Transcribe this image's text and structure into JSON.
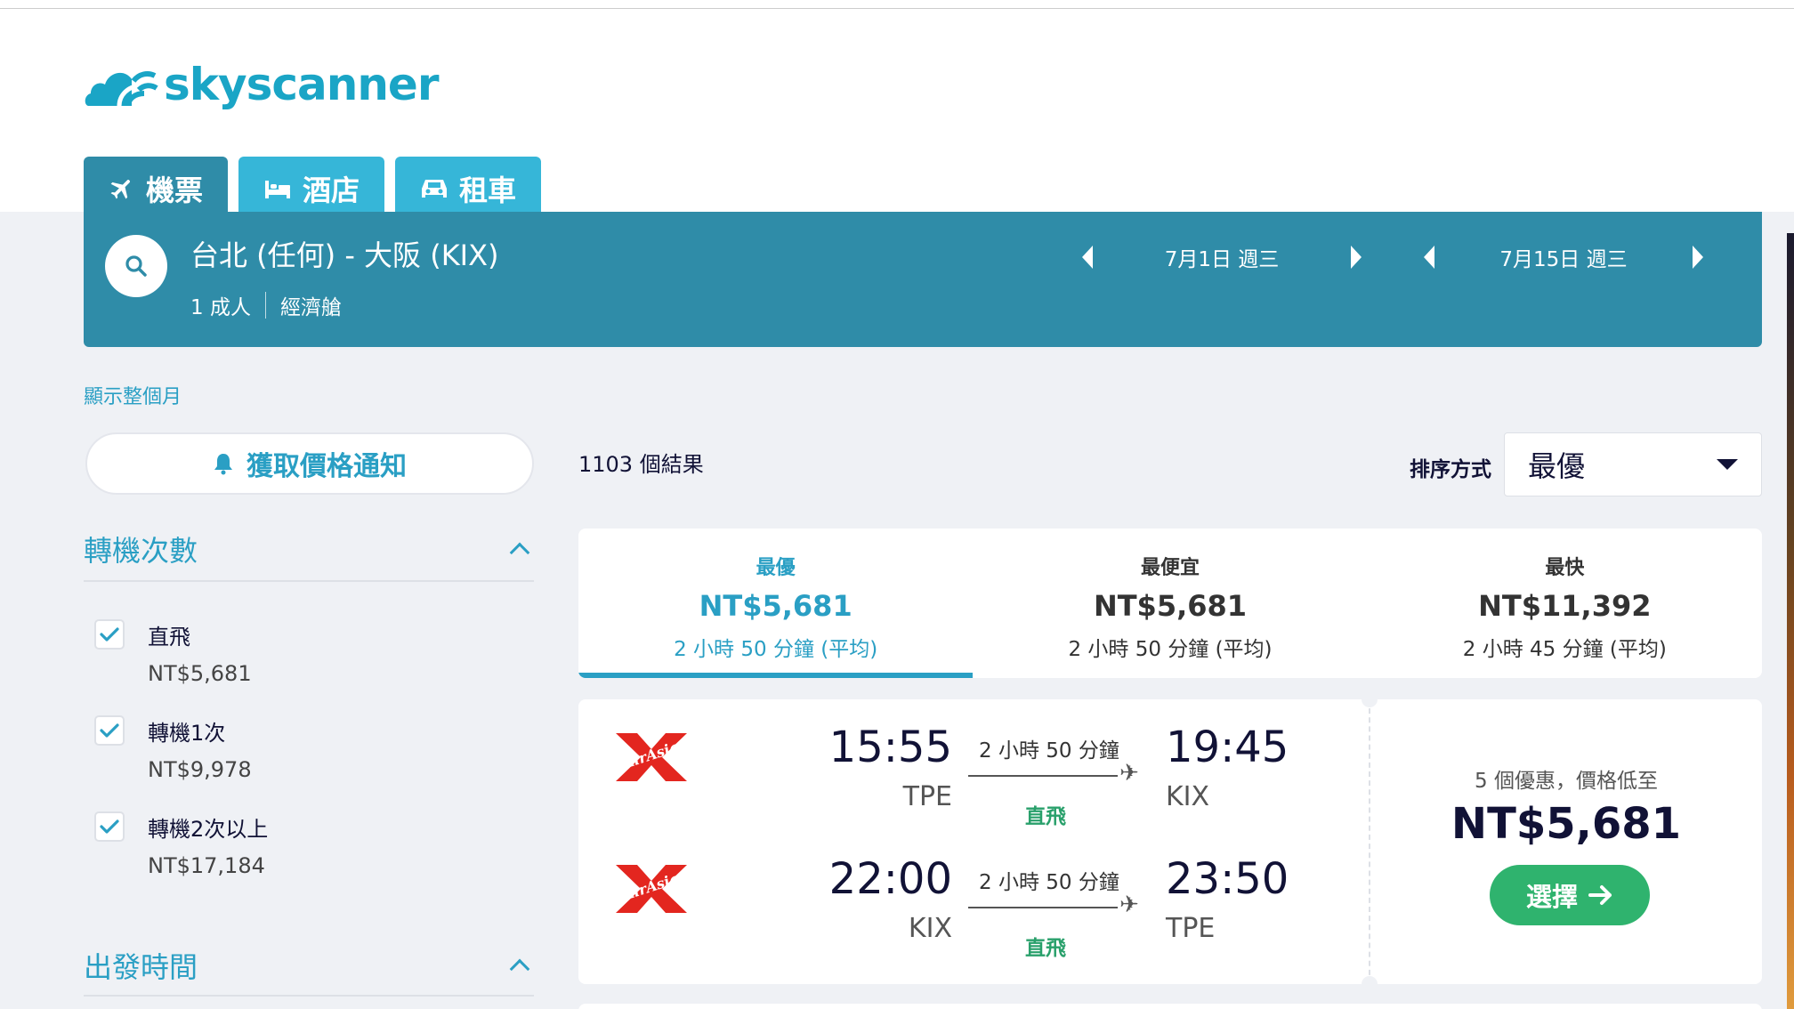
{
  "brand": {
    "name": "skyscanner",
    "color": "#1aa5c6"
  },
  "tabs": [
    {
      "label": "機票",
      "icon": "plane-icon",
      "active": true
    },
    {
      "label": "酒店",
      "icon": "bed-icon",
      "active": false
    },
    {
      "label": "租車",
      "icon": "car-icon",
      "active": false
    }
  ],
  "search": {
    "route": "台北 (任何) - 大阪 (KIX)",
    "passengers": "1 成人",
    "cabin": "經濟艙",
    "depart_date": "7月1日 週三",
    "return_date": "7月15日 週三"
  },
  "sidebar": {
    "month_link": "顯示整個月",
    "alert_button": "獲取價格通知",
    "stops_title": "轉機次數",
    "stops": [
      {
        "label": "直飛",
        "price": "NT$5,681",
        "checked": true
      },
      {
        "label": "轉機1次",
        "price": "NT$9,978",
        "checked": true
      },
      {
        "label": "轉機2次以上",
        "price": "NT$17,184",
        "checked": true
      }
    ],
    "departure_title": "出發時間"
  },
  "results": {
    "count": "1103 個結果",
    "sort_label": "排序方式",
    "sort_value": "最優"
  },
  "sort_tabs": [
    {
      "title": "最優",
      "price": "NT$5,681",
      "duration": "2 小時 50 分鐘 (平均)",
      "active": true
    },
    {
      "title": "最便宜",
      "price": "NT$5,681",
      "duration": "2 小時 50 分鐘 (平均)",
      "active": false
    },
    {
      "title": "最快",
      "price": "NT$11,392",
      "duration": "2 小時 45 分鐘 (平均)",
      "active": false
    }
  ],
  "flight": {
    "legs": [
      {
        "airline": "AirAsia",
        "dep_time": "15:55",
        "dep_code": "TPE",
        "duration": "2 小時 50 分鐘",
        "stops": "直飛",
        "arr_time": "19:45",
        "arr_code": "KIX"
      },
      {
        "airline": "AirAsia",
        "dep_time": "22:00",
        "dep_code": "KIX",
        "duration": "2 小時 50 分鐘",
        "stops": "直飛",
        "arr_time": "23:50",
        "arr_code": "TPE"
      }
    ],
    "deals": "5 個優惠，價格低至",
    "price": "NT$5,681",
    "select_label": "選擇"
  },
  "colors": {
    "primary_dark": "#2f8ca8",
    "primary_light": "#36b6d8",
    "link": "#2a9fc4",
    "success": "#2fb36e",
    "airasia_red": "#e3261f"
  }
}
